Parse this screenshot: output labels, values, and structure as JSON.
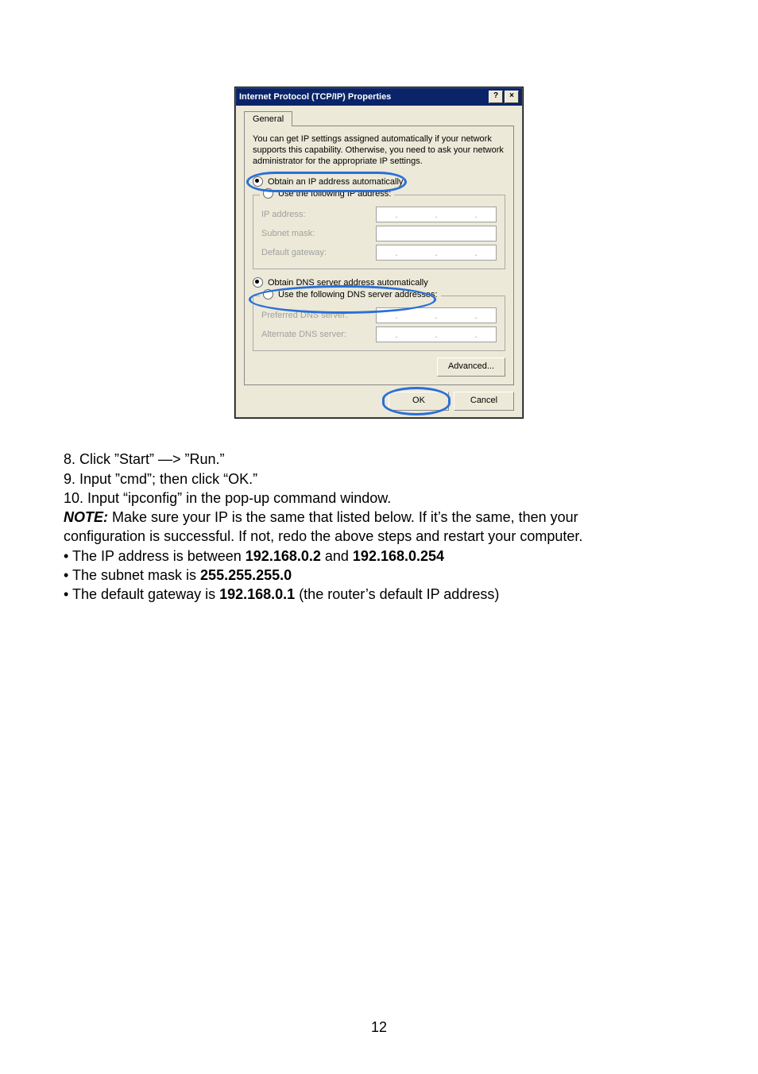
{
  "dialog": {
    "title": "Internet Protocol (TCP/IP) Properties",
    "tab": "General",
    "intro": "You can get IP settings assigned automatically if your network supports this capability. Otherwise, you need to ask your network administrator for the appropriate IP settings.",
    "radio_auto_ip": "Obtain an IP address automatically",
    "radio_manual_ip": "Use the following IP address:",
    "ip_address_label": "IP address:",
    "subnet_label": "Subnet mask:",
    "gateway_label": "Default gateway:",
    "radio_auto_dns": "Obtain DNS server address automatically",
    "radio_manual_dns": "Use the following DNS server addresses:",
    "preferred_dns_label": "Preferred DNS server:",
    "alternate_dns_label": "Alternate DNS server:",
    "advanced_label": "Advanced...",
    "ok_label": "OK",
    "cancel_label": "Cancel",
    "help_label": "?",
    "close_label": "×"
  },
  "text": {
    "line1a": "8. Click ”Start” —> ”Run.”",
    "line2a": "9. Input ”cmd”; then click “OK.”",
    "line3a": "10. Input “ipconfig” in the pop-up command window.",
    "note_prefix": "NOTE:",
    "note_body_a": " Make sure your IP is the same that listed below. If it’s the same, then your",
    "note_body_b": "configuration is successful. If not, redo the above steps and restart your computer.",
    "bullet1_a": "• The IP address is between ",
    "bullet1_b": "192.168.0.2",
    "bullet1_c": " and ",
    "bullet1_d": "192.168.0.254",
    "bullet2_a": "• The subnet mask is ",
    "bullet2_b": "255.255.255.0",
    "bullet3_a": "• The default gateway is ",
    "bullet3_b": "192.168.0.1",
    "bullet3_c": " (the router’s default IP address)"
  },
  "page_number": "12"
}
